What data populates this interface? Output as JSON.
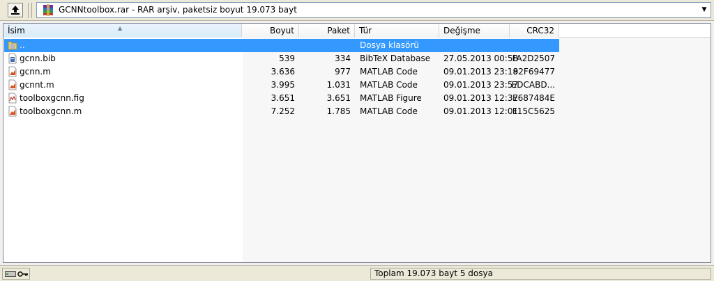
{
  "address": {
    "text": "GCNNtoolbox.rar - RAR arşiv, paketsiz boyut 19.073 bayt",
    "up_icon": "up-folder-icon",
    "archive_icon": "winrar-archive-icon",
    "dropdown_icon": "chevron-down-icon"
  },
  "columns": {
    "name": "İsim",
    "size": "Boyut",
    "packed": "Paket",
    "type": "Tür",
    "modified": "Değişme",
    "crc": "CRC32"
  },
  "rows": [
    {
      "name": "..",
      "size": "",
      "packed": "",
      "type": "Dosya klasörü",
      "modified": "",
      "crc": "",
      "icon": "folder-up-icon",
      "selected": true
    },
    {
      "name": "gcnn.bib",
      "size": "539",
      "packed": "334",
      "type": "BibTeX Database",
      "modified": "27.05.2013 00:58",
      "crc": "FA2D2507",
      "icon": "bib-file-icon"
    },
    {
      "name": "gcnn.m",
      "size": "3.636",
      "packed": "977",
      "type": "MATLAB Code",
      "modified": "09.01.2013 23:18",
      "crc": "92F69477",
      "icon": "matlab-code-icon"
    },
    {
      "name": "gcnnt.m",
      "size": "3.995",
      "packed": "1.031",
      "type": "MATLAB Code",
      "modified": "09.01.2013 23:57",
      "crc": "EDCABD...",
      "icon": "matlab-code-icon"
    },
    {
      "name": "toolboxgcnn.fig",
      "size": "3.651",
      "packed": "3.651",
      "type": "MATLAB Figure",
      "modified": "09.01.2013 12:37",
      "crc": "E687484E",
      "icon": "matlab-figure-icon"
    },
    {
      "name": "toolboxgcnn.m",
      "size": "7.252",
      "packed": "1.785",
      "type": "MATLAB Code",
      "modified": "09.01.2013 12:01",
      "crc": "F15C5625",
      "icon": "matlab-code-icon"
    }
  ],
  "status": {
    "total": "Toplam 19.073 bayt 5 dosya",
    "drive_icon": "drive-icon",
    "key_icon": "key-icon"
  },
  "colors": {
    "selection": "#3399ff",
    "window_bg": "#ece9d8"
  }
}
